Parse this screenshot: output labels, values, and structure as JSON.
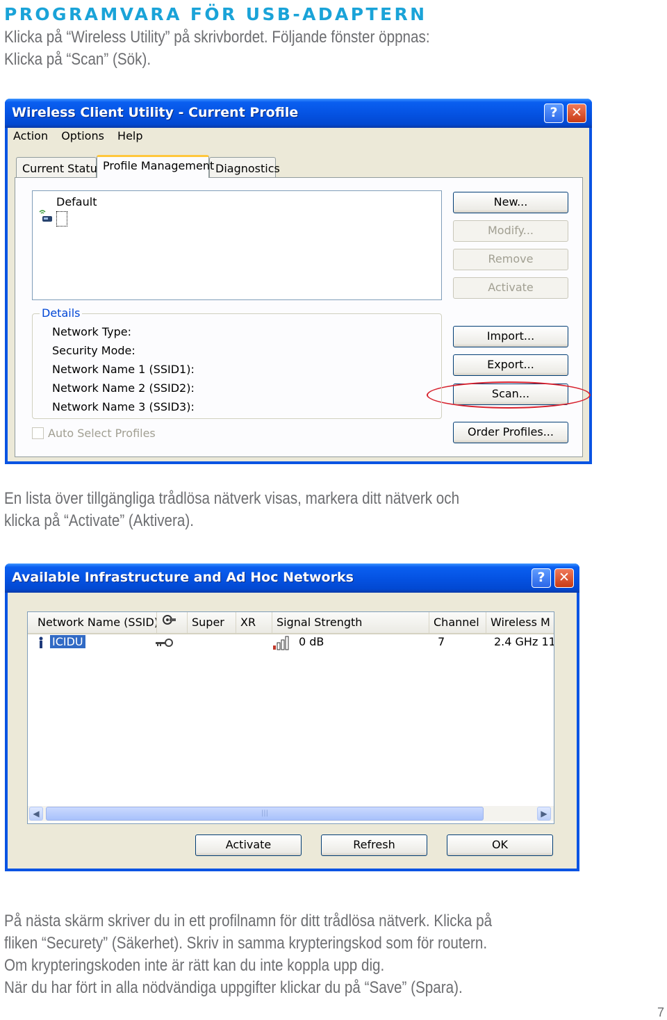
{
  "heading": "PROGRAMVARA FÖR USB-ADAPTERN",
  "intro": [
    "Klicka på “Wireless Utility” på skrivbordet. Följande fönster öppnas:",
    "Klicka på “Scan” (Sök)."
  ],
  "window1": {
    "title": "Wireless Client Utility - Current Profile",
    "help_btn": "?",
    "close_btn": "✕",
    "menu": [
      "Action",
      "Options",
      "Help"
    ],
    "tabs": [
      "Current Status",
      "Profile Management",
      "Diagnostics"
    ],
    "active_tab": "Profile Management",
    "profiles": [
      "Default"
    ],
    "buttons": {
      "new": "New...",
      "modify": "Modify...",
      "remove": "Remove",
      "activate": "Activate",
      "import": "Import...",
      "export": "Export...",
      "scan": "Scan...",
      "order": "Order Profiles..."
    },
    "details": {
      "title": "Details",
      "fields": [
        "Network Type:",
        "Security Mode:",
        "Network Name 1 (SSID1):",
        "Network Name 2 (SSID2):",
        "Network Name 3 (SSID3):"
      ]
    },
    "auto_select": "Auto Select Profiles",
    "highlight_color": "#d7202c"
  },
  "middle": [
    "En lista över tillgängliga trådlösa nätverk visas, markera ditt nätverk och",
    "klicka på “Activate” (Aktivera)."
  ],
  "window2": {
    "title": "Available Infrastructure and Ad Hoc Networks",
    "help_btn": "?",
    "close_btn": "✕",
    "columns": [
      "Network Name (SSID)",
      "",
      "Super",
      "XR",
      "Signal Strength",
      "Channel",
      "Wireless M"
    ],
    "rows": [
      {
        "ssid": "ICIDU",
        "signal": "0 dB",
        "channel": "7",
        "mode": "2.4 GHz 11"
      }
    ],
    "scroll_grip": "|||",
    "buttons": {
      "activate": "Activate",
      "refresh": "Refresh",
      "ok": "OK"
    }
  },
  "footer": [
    "På nästa skärm skriver du in ett profilnamn för ditt trådlösa nätverk. Klicka på",
    "fliken “Securety” (Säkerhet). Skriv in samma krypteringskod som för routern.",
    "Om krypteringskoden inte är rätt kan du inte koppla upp dig.",
    "När du har fört in alla nödvändiga uppgifter klickar du på “Save” (Spara)."
  ],
  "page_number": "7",
  "colors": {
    "heading": "#1aa3d8",
    "body_text": "#6d6e71",
    "xp_blue": "#0a54e3"
  }
}
